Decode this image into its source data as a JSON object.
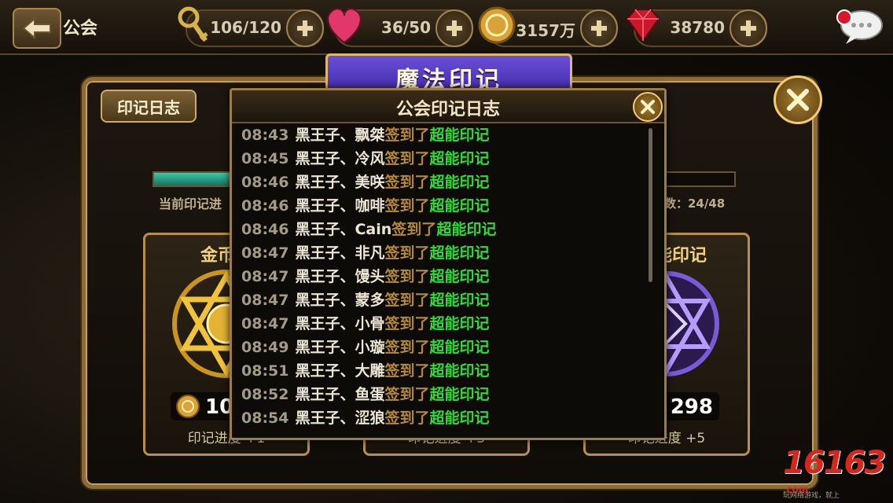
{
  "topbar": {
    "title": "公会",
    "resources": [
      {
        "icon": "key-icon",
        "value": "106/120"
      },
      {
        "icon": "heart-icon",
        "value": "36/50"
      },
      {
        "icon": "coin-icon",
        "value": "3157万"
      },
      {
        "icon": "gem-icon",
        "value": "38780"
      }
    ]
  },
  "panel": {
    "banner": "魔法印记",
    "log_tab": "印记日志",
    "progress_label": "当前印记进",
    "count_label": "人数：24/48",
    "progress_fraction": 0.2
  },
  "cards": [
    {
      "title": "金币印",
      "cost": "10",
      "note": "印记进度 +1",
      "emblem": "gold-hexagram-icon"
    },
    {
      "title": "",
      "cost": "",
      "note": "印记进度 +3",
      "emblem": ""
    },
    {
      "title": "能印记",
      "cost": "298",
      "note": "印记进度 +5",
      "emblem": "purple-hexagram-icon"
    }
  ],
  "log": {
    "title": "公会印记日志",
    "verb": "签到了",
    "item": "超能印记",
    "entries": [
      {
        "time": "08:43",
        "name": "黑王子、飘桀"
      },
      {
        "time": "08:45",
        "name": "黑王子、冷风"
      },
      {
        "time": "08:46",
        "name": "黑王子、美咲"
      },
      {
        "time": "08:46",
        "name": "黑王子、咖啡"
      },
      {
        "time": "08:46",
        "name": "黑王子、Cain"
      },
      {
        "time": "08:47",
        "name": "黑王子、非凡"
      },
      {
        "time": "08:47",
        "name": "黑王子、馒头"
      },
      {
        "time": "08:47",
        "name": "黑王子、蒙多"
      },
      {
        "time": "08:47",
        "name": "黑王子、小骨"
      },
      {
        "time": "08:49",
        "name": "黑王子、小璇"
      },
      {
        "time": "08:51",
        "name": "黑王子、大雕"
      },
      {
        "time": "08:52",
        "name": "黑王子、鱼蛋"
      },
      {
        "time": "08:54",
        "name": "黑王子、涩狼"
      }
    ]
  },
  "watermark": {
    "text": "16163",
    "suffix": ".com",
    "tagline": "玩网络游戏，就上"
  }
}
